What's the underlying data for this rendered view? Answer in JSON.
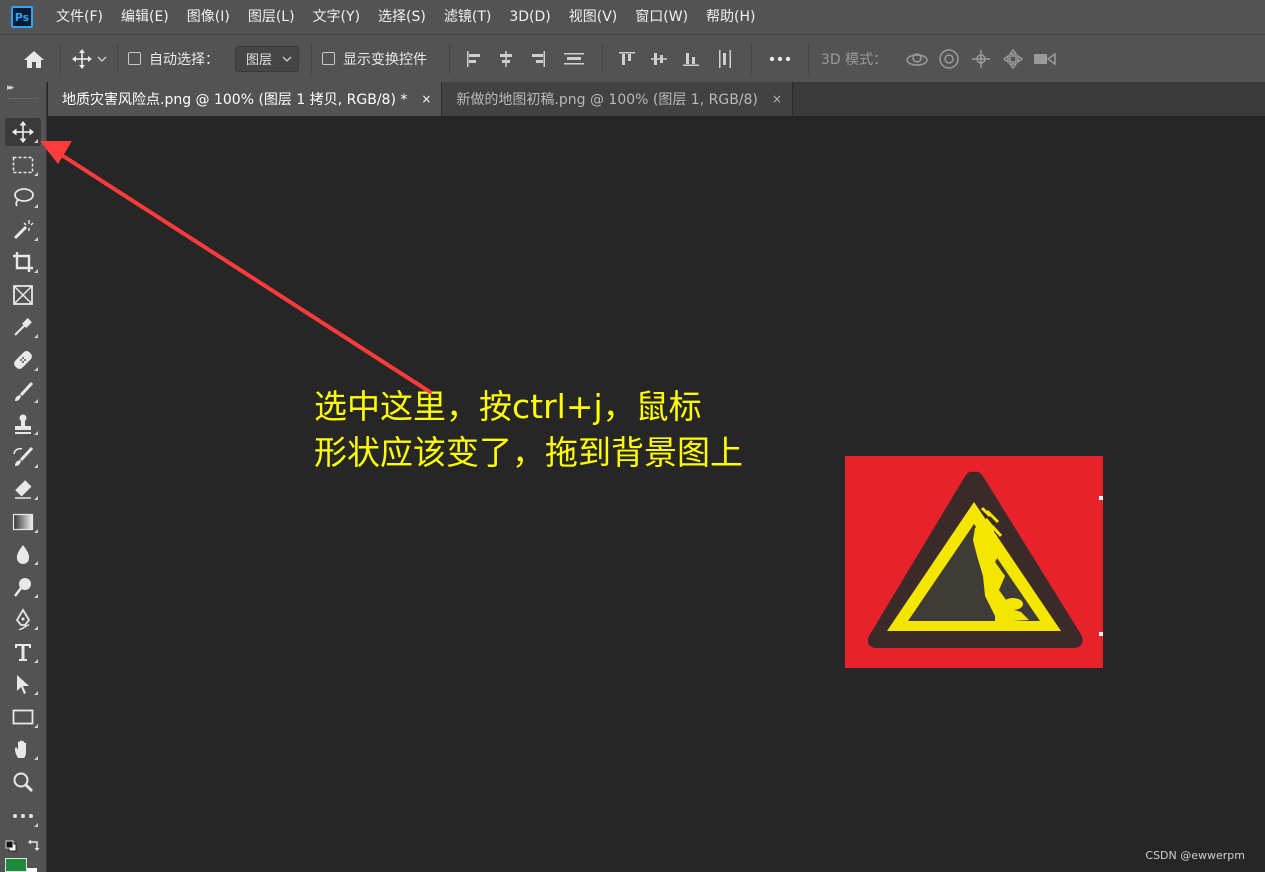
{
  "app": {
    "logo_text": "Ps"
  },
  "menu": [
    "文件(F)",
    "编辑(E)",
    "图像(I)",
    "图层(L)",
    "文字(Y)",
    "选择(S)",
    "滤镜(T)",
    "3D(D)",
    "视图(V)",
    "窗口(W)",
    "帮助(H)"
  ],
  "options": {
    "auto_select_label": "自动选择：",
    "auto_select_target": "图层",
    "show_transform_label": "显示变换控件",
    "mode_3d_label": "3D 模式："
  },
  "tabs": [
    {
      "title": "地质灾害风险点.png @ 100% (图层 1 拷贝, RGB/8) *",
      "close": "×"
    },
    {
      "title": "新做的地图初稿.png @ 100% (图层 1, RGB/8)",
      "close": "×"
    }
  ],
  "annotation": {
    "line1": "选中这里，按ctrl+j，鼠标",
    "line2": "形状应该变了，拖到背景图上"
  },
  "watermark": "CSDN @ewwerpm",
  "colors": {
    "annotation_text": "#ffff00",
    "arrow": "#ff3b3b",
    "sign_background": "#e8222a",
    "sign_triangle": "#f5e600",
    "foreground_swatch": "#1e8a3c"
  },
  "tools": [
    "move-tool",
    "marquee-tool",
    "lasso-tool",
    "magic-wand-tool",
    "crop-tool",
    "frame-tool",
    "eyedropper-tool",
    "healing-brush-tool",
    "brush-tool",
    "clone-stamp-tool",
    "history-brush-tool",
    "eraser-tool",
    "gradient-tool",
    "blur-tool",
    "dodge-tool",
    "pen-tool",
    "type-tool",
    "path-selection-tool",
    "rectangle-tool",
    "hand-tool",
    "zoom-tool",
    "more-tools"
  ]
}
